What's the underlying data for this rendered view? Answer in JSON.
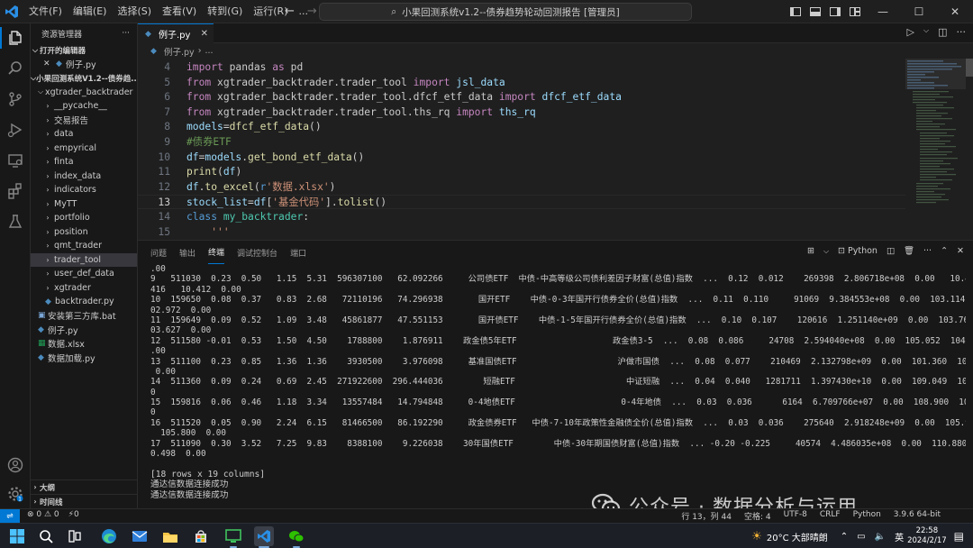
{
  "titlebar": {
    "menu": [
      "文件(F)",
      "编辑(E)",
      "选择(S)",
      "查看(V)",
      "转到(G)",
      "运行(R)",
      "..."
    ],
    "command_center": "小果回测系统v1.2--债券趋势轮动回测报告 [管理员]"
  },
  "sidebar": {
    "header": "资源管理器",
    "open_editors_title": "打开的编辑器",
    "open_editors": [
      {
        "name": "例子.py"
      }
    ],
    "workspace_title": "小果回测系统V1.2--债券趋...",
    "folder_root": "xgtrader_backtrader",
    "folders": [
      "__pycache__",
      "交易报告",
      "data",
      "empyrical",
      "finta",
      "index_data",
      "indicators",
      "MyTT",
      "portfolio",
      "position",
      "qmt_trader",
      "trader_tool",
      "user_def_data",
      "xgtrader"
    ],
    "root_files": [
      {
        "name": "backtrader.py",
        "type": "py",
        "indent": 2
      },
      {
        "name": "安装第三方库.bat",
        "type": "bat",
        "indent": 1
      },
      {
        "name": "例子.py",
        "type": "py",
        "indent": 1
      },
      {
        "name": "数据.xlsx",
        "type": "xlsx",
        "indent": 1
      },
      {
        "name": "数据加载.py",
        "type": "py",
        "indent": 1
      }
    ],
    "outline_label": "大纲",
    "timeline_label": "时间线"
  },
  "editor": {
    "tab_label": "例子.py",
    "breadcrumb": [
      "例子.py",
      "..."
    ],
    "lines": [
      {
        "n": "4",
        "tokens": [
          [
            "kw",
            "import"
          ],
          [
            "def",
            " pandas "
          ],
          [
            "kw",
            "as"
          ],
          [
            "def",
            " pd"
          ]
        ]
      },
      {
        "n": "5",
        "tokens": [
          [
            "kw",
            "from"
          ],
          [
            "def",
            " xgtrader_backtrader.trader_tool "
          ],
          [
            "kw",
            "import"
          ],
          [
            "def",
            " "
          ],
          [
            "var",
            "jsl_data"
          ]
        ]
      },
      {
        "n": "6",
        "tokens": [
          [
            "kw",
            "from"
          ],
          [
            "def",
            " xgtrader_backtrader.trader_tool.dfcf_etf_data "
          ],
          [
            "kw",
            "import"
          ],
          [
            "def",
            " "
          ],
          [
            "var",
            "dfcf_etf_data"
          ]
        ]
      },
      {
        "n": "7",
        "tokens": [
          [
            "kw",
            "from"
          ],
          [
            "def",
            " xgtrader_backtrader.trader_tool.ths_rq "
          ],
          [
            "kw",
            "import"
          ],
          [
            "def",
            " "
          ],
          [
            "var",
            "ths_rq"
          ]
        ]
      },
      {
        "n": "8",
        "tokens": [
          [
            "var",
            "models"
          ],
          [
            "def",
            "="
          ],
          [
            "fn",
            "dfcf_etf_data"
          ],
          [
            "def",
            "()"
          ]
        ]
      },
      {
        "n": "9",
        "tokens": [
          [
            "cmt",
            "#债券ETF"
          ]
        ]
      },
      {
        "n": "10",
        "tokens": [
          [
            "var",
            "df"
          ],
          [
            "def",
            "="
          ],
          [
            "var",
            "models"
          ],
          [
            "def",
            "."
          ],
          [
            "fn",
            "get_bond_etf_data"
          ],
          [
            "def",
            "()"
          ]
        ]
      },
      {
        "n": "11",
        "tokens": [
          [
            "fn",
            "print"
          ],
          [
            "def",
            "("
          ],
          [
            "var",
            "df"
          ],
          [
            "def",
            ")"
          ]
        ]
      },
      {
        "n": "12",
        "tokens": [
          [
            "var",
            "df"
          ],
          [
            "def",
            "."
          ],
          [
            "fn",
            "to_excel"
          ],
          [
            "def",
            "("
          ],
          [
            "kwb",
            "r"
          ],
          [
            "str",
            "'数据.xlsx'"
          ],
          [
            "def",
            ")"
          ]
        ]
      },
      {
        "n": "13",
        "tokens": [
          [
            "var",
            "stock_list"
          ],
          [
            "def",
            "="
          ],
          [
            "var",
            "df"
          ],
          [
            "def",
            "["
          ],
          [
            "str",
            "'基金代码'"
          ],
          [
            "def",
            "]."
          ],
          [
            "fn",
            "tolist"
          ],
          [
            "def",
            "()"
          ]
        ]
      },
      {
        "n": "14",
        "tokens": [
          [
            "kwb",
            "class"
          ],
          [
            "def",
            " "
          ],
          [
            "cls",
            "my_backtrader"
          ],
          [
            "def",
            ":"
          ]
        ]
      },
      {
        "n": "15",
        "tokens": [
          [
            "def",
            "    "
          ],
          [
            "str",
            "'''"
          ]
        ]
      }
    ]
  },
  "panel": {
    "tabs": [
      "问题",
      "输出",
      "终端",
      "调试控制台",
      "端口"
    ],
    "active_tab": "终端",
    "shell": "Python",
    "terminal_lines": [
      ".00",
      "9   511030  0.23  0.50   1.15  5.31  596307100   62.092266     公司债ETF  中债-中高等级公司债利差因子财富(总值)指数  ...  0.12  0.012    269398  2.806718e+08  0.00   10.425   10.",
      "416   10.412  0.00",
      "10  159650  0.08  0.37   0.83  2.68   72110196   74.296938       国开ETF    中债-0-3年国开行债券全价(总值)指数  ...  0.11  0.110     91069  9.384553e+08  0.00  103.114  103.031  1",
      "02.972  0.00",
      "11  159649  0.09  0.52   1.09  3.48   45861877   47.551153       国开债ETF    中债-1-5年国开行债券全价(总值)指数  ...  0.10  0.107    120616  1.251140e+09  0.00  103.760  103.691  1",
      "03.627  0.00",
      "12  511580 -0.01  0.53   1.50  4.50    1788800    1.876911    政金债5年ETF                   政金债3-5  ...  0.08  0.086     24708  2.594040e+08  0.00  105.052  104.852  104.829  0",
      ".00",
      "13  511100  0.23  0.85   1.36  1.36    3930500    3.976098     基准国债ETF                    沪做市国债  ...  0.08  0.077    210469  2.132798e+09  0.00  101.360  101.269  101.279",
      " 0.00",
      "14  511360  0.09  0.24   0.69  2.45  271922600  296.444036        短融ETF                      中证短融  ...  0.04  0.040   1281711  1.397430e+10  0.00  109.049  109.016  108.997  0.",
      "0",
      "15  159816  0.06  0.46   1.18  3.34   13557484   14.794848     0-4地债ETF                     0-4年地债  ...  0.03  0.036      6164  6.709766e+07  0.00  108.900  108.794  108.781  0.",
      "0",
      "16  511520  0.05  0.90   2.24  6.15   81466500   86.192290     政金债券ETF   中债-7-10年政策性金融债全价(总值)指数  ...  0.03  0.036    275640  2.918248e+09  0.00  105.960  105.770",
      "  105.800  0.00",
      "17  511090  0.30  3.52   7.25  9.83    8388100    9.226038    30年国债ETF        中债-30年期国债财富(总值)指数  ... -0.20 -0.225     40574  4.486035e+08  0.00  110.880  110.108  11",
      "0.498  0.00",
      "",
      "[18 rows x 19 columns]",
      "通达信数据连接成功",
      "通达信数据连接成功"
    ]
  },
  "watermark": {
    "text": "公众号 · 数据分析与运用"
  },
  "statusbar": {
    "errors": "⊗ 0 ⚠ 0",
    "ports": "⚡0",
    "position": "行 13，列 44",
    "spaces": "空格: 4",
    "encoding": "UTF-8",
    "eol": "CRLF",
    "language": "Python",
    "python_version": "3.9.6 64-bit"
  },
  "taskbar": {
    "weather": "20°C 大部晴朗",
    "ime": "英",
    "time": "22:58",
    "date": "2024/2/17"
  },
  "colors": {
    "accent": "#0078d4",
    "editor_bg": "#1f1f1f",
    "panel_bg": "#181818"
  }
}
